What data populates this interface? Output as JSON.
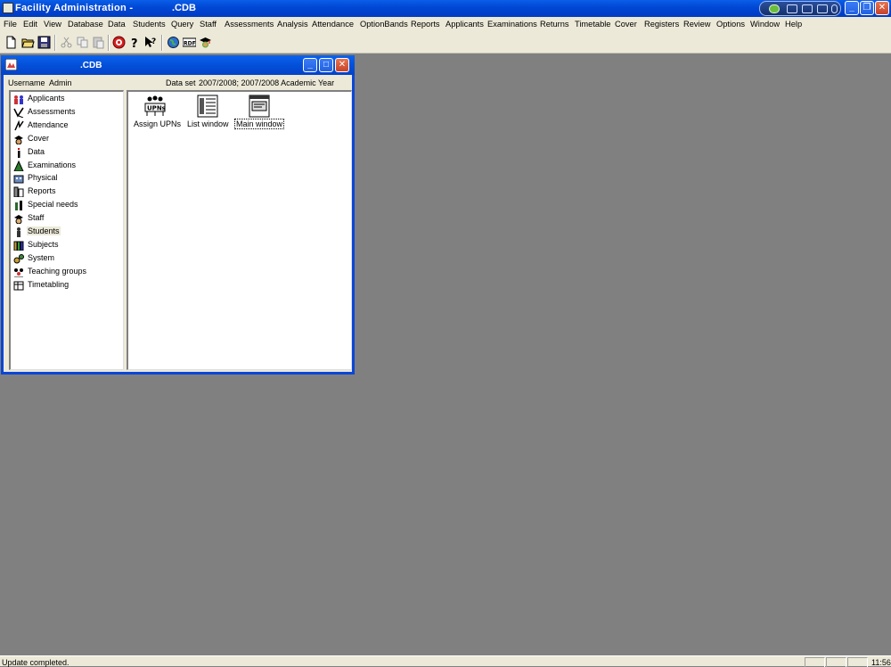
{
  "app": {
    "title": "Facility Administration -",
    "title_suffix": ".CDB",
    "accent": "#0a46d8",
    "desktop_color": "#808080"
  },
  "menu": [
    "File",
    "Edit",
    "View",
    "Database",
    "Data",
    "Students",
    "Query",
    "Staff",
    "Assessments",
    "Analysis",
    "Attendance",
    "OptionBands",
    "Reports",
    "Applicants",
    "Examinations",
    "Returns",
    "Timetable",
    "Cover",
    "Registers",
    "Review",
    "Options",
    "Window",
    "Help"
  ],
  "toolbar": {
    "icons": [
      "new-file-icon",
      "open-folder-icon",
      "save-disk-icon",
      "cut-icon",
      "copy-icon",
      "paste-icon",
      "target-icon",
      "help-question-icon",
      "whats-this-icon",
      "world-icon",
      "rdf-icon",
      "graduate-icon"
    ]
  },
  "child_window": {
    "title": ".CDB",
    "username_label": "Username",
    "username_value": "Admin",
    "dataset_label": "Data set",
    "dataset_value": "2007/2008; 2007/2008 Academic Year",
    "tree": [
      {
        "label": "Applicants",
        "icon": "applicants-icon"
      },
      {
        "label": "Assessments",
        "icon": "assessments-icon"
      },
      {
        "label": "Attendance",
        "icon": "attendance-icon"
      },
      {
        "label": "Cover",
        "icon": "cover-icon"
      },
      {
        "label": "Data",
        "icon": "data-icon"
      },
      {
        "label": "Examinations",
        "icon": "examinations-icon"
      },
      {
        "label": "Physical",
        "icon": "physical-icon"
      },
      {
        "label": "Reports",
        "icon": "reports-icon"
      },
      {
        "label": "Special needs",
        "icon": "special-needs-icon"
      },
      {
        "label": "Staff",
        "icon": "staff-icon"
      },
      {
        "label": "Students",
        "icon": "students-icon",
        "selected": true
      },
      {
        "label": "Subjects",
        "icon": "subjects-icon"
      },
      {
        "label": "System",
        "icon": "system-icon"
      },
      {
        "label": "Teaching groups",
        "icon": "teaching-groups-icon"
      },
      {
        "label": "Timetabling",
        "icon": "timetabling-icon"
      }
    ],
    "pane_items": [
      {
        "label": "Assign UPNs",
        "icon": "assign-upns-icon",
        "badge": "UPNs"
      },
      {
        "label": "List window",
        "icon": "list-window-icon"
      },
      {
        "label": "Main window",
        "icon": "main-window-icon",
        "focused": true
      }
    ]
  },
  "status": {
    "message": "Update completed.",
    "clock": "11:56"
  }
}
